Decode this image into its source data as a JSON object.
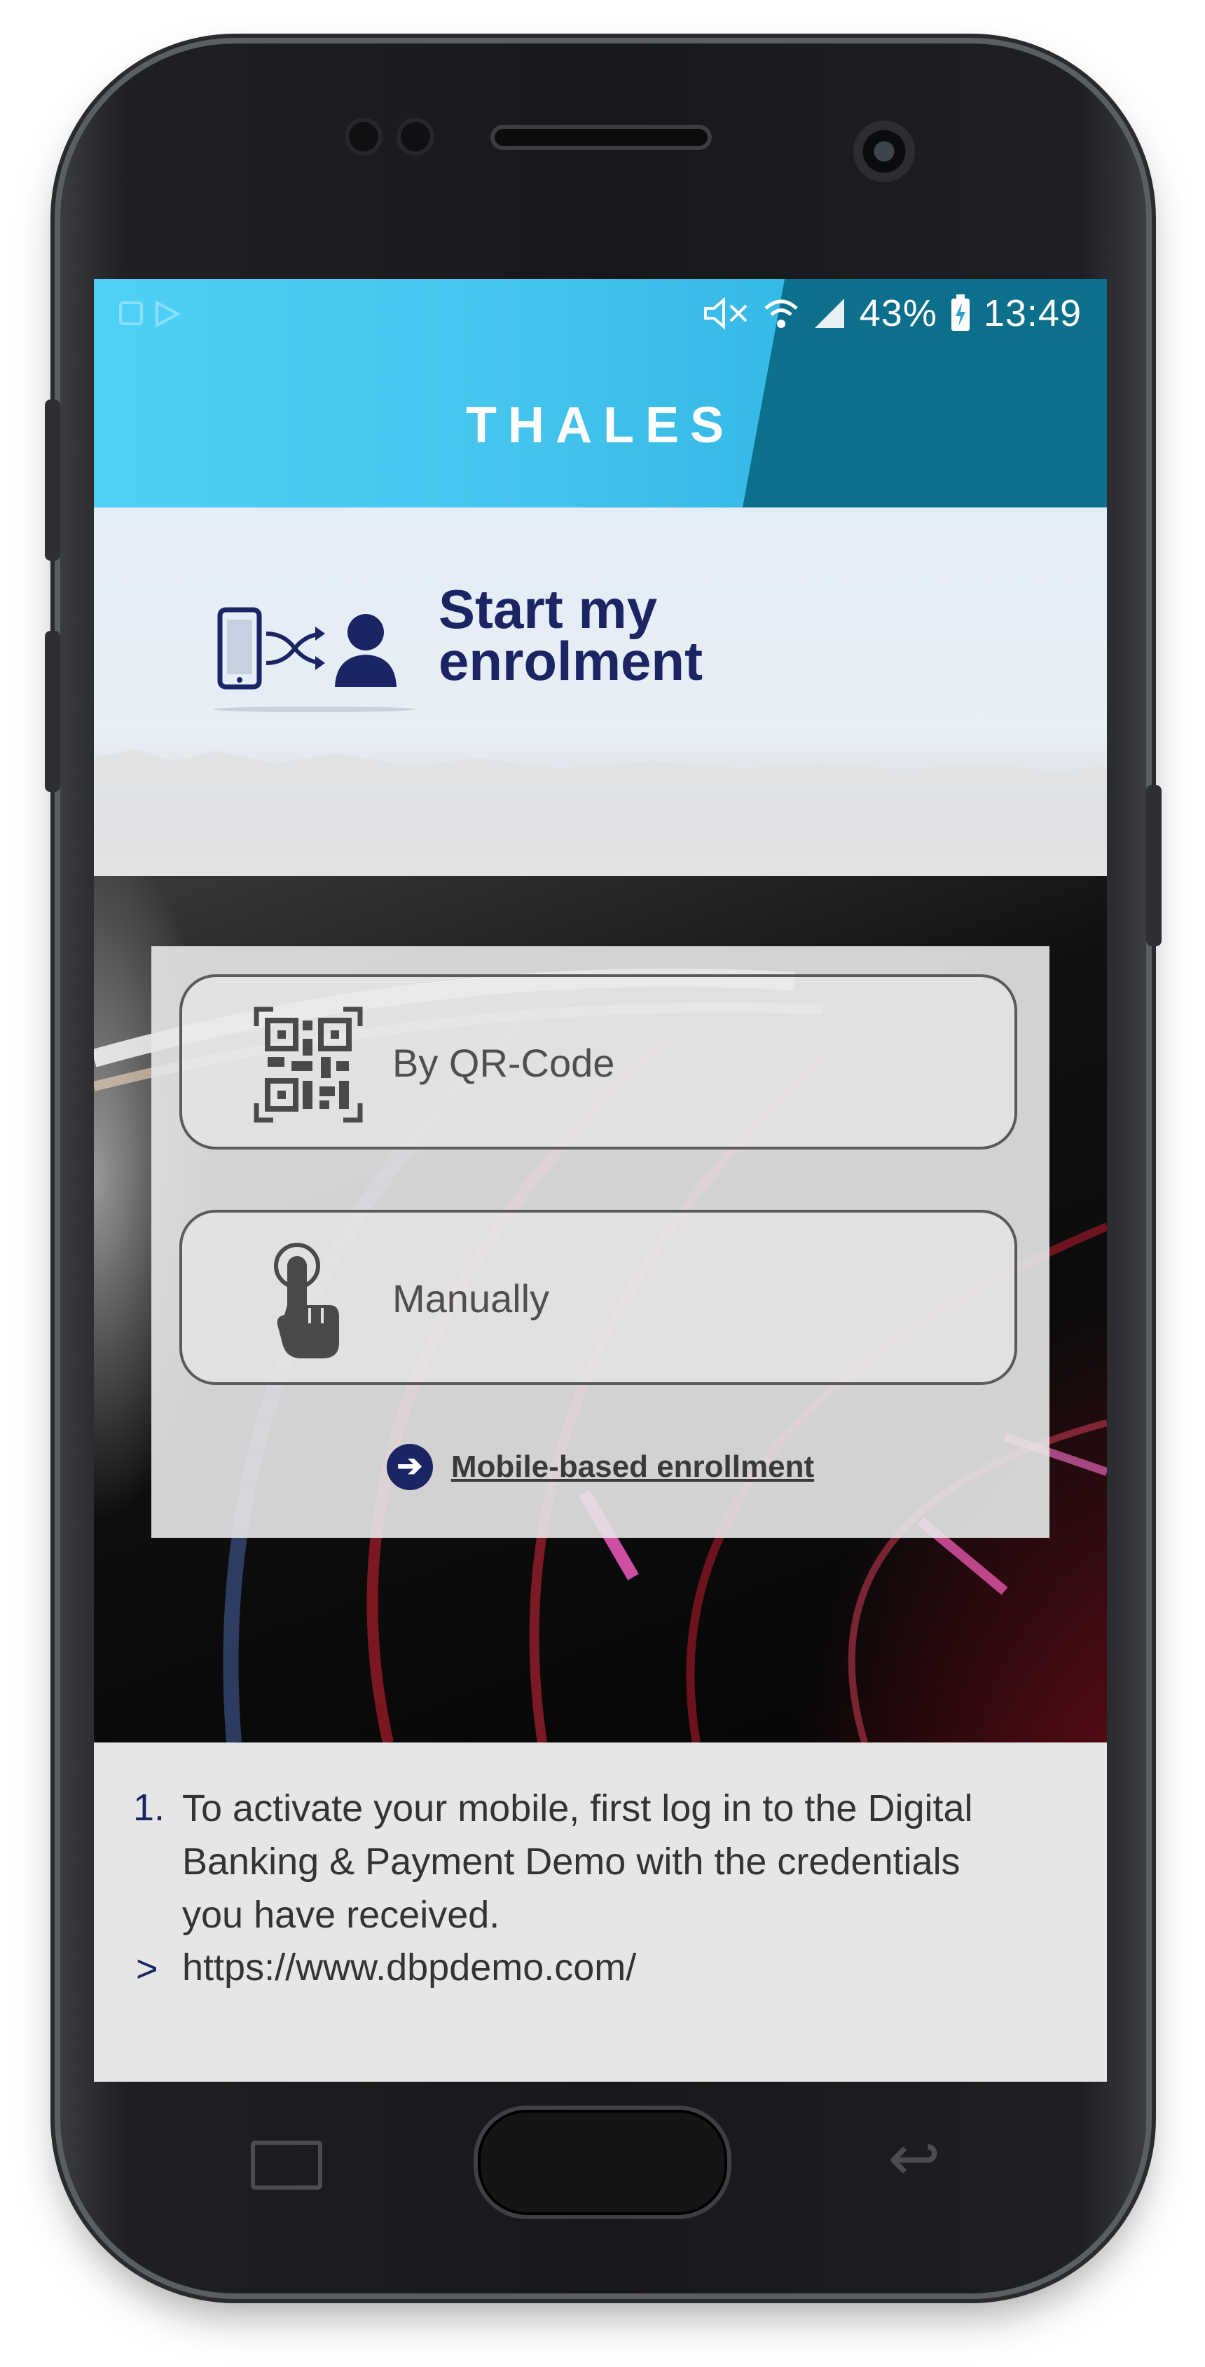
{
  "status_bar": {
    "battery": "43%",
    "time": "13:49"
  },
  "header": {
    "brand": "THALES"
  },
  "hero": {
    "title_line1": "Start my",
    "title_line2": "enrolment"
  },
  "options": [
    {
      "label": "By QR-Code",
      "icon": "qr-code-icon"
    },
    {
      "label": "Manually",
      "icon": "tap-finger-icon"
    }
  ],
  "mobile_link": {
    "label": "Mobile-based enrollment",
    "icon": "arrow-circle-right-icon"
  },
  "info": {
    "item_number": "1.",
    "text": "To activate your mobile, first log in to the Digital Banking & Payment Demo with the credentials you have received.",
    "link_marker": ">",
    "url": "https://www.dbpdemo.com/"
  },
  "colors": {
    "header_cyan": "#46c5ee",
    "header_dark": "#0c6f8b",
    "brand_navy": "#1b2564"
  }
}
